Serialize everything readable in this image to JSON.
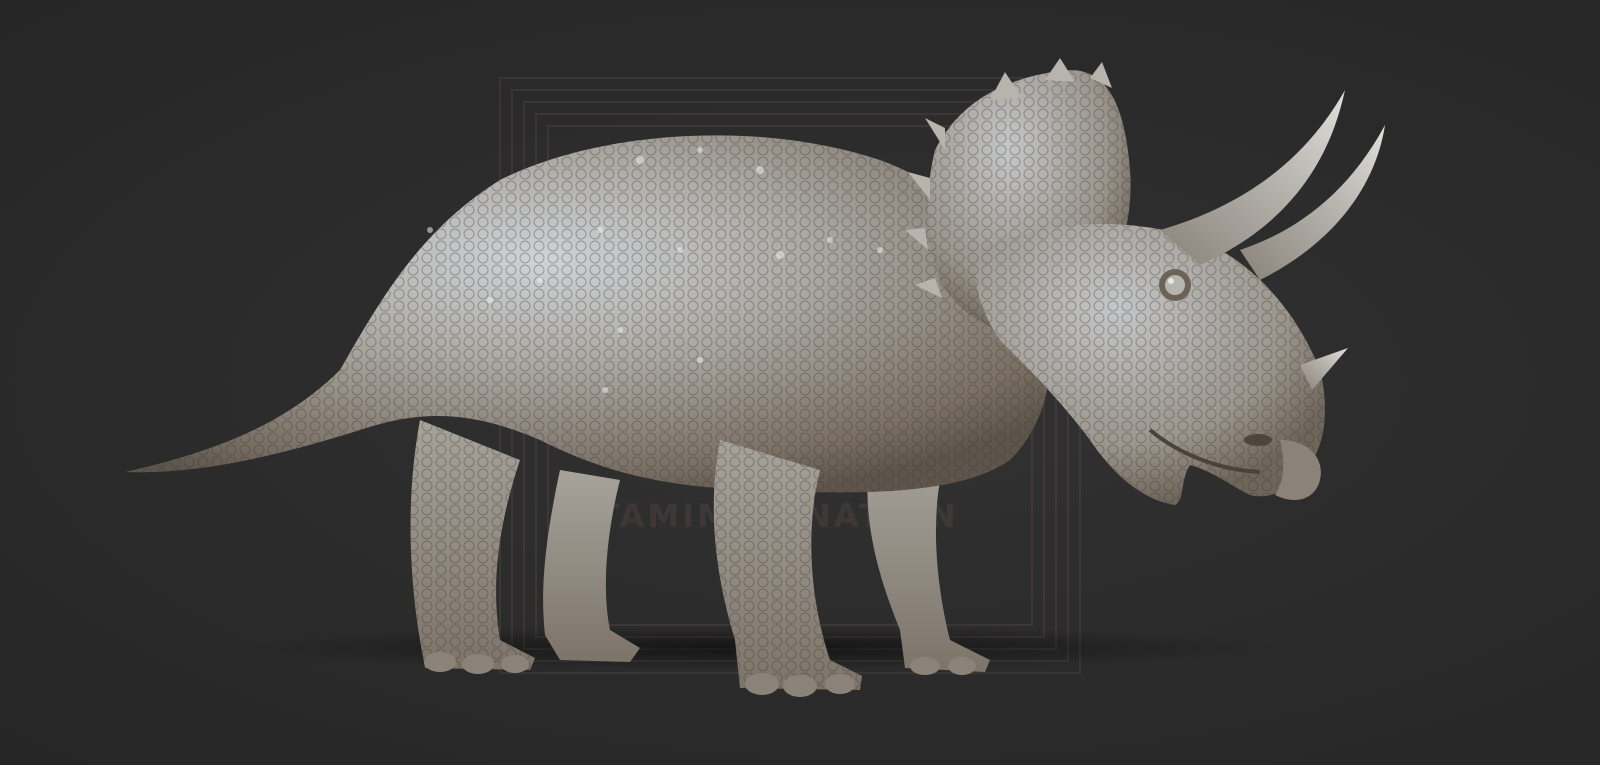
{
  "scene": {
    "subject": "triceratops-sculpt",
    "background_color": "#2b2b2b",
    "skin_highlight": "#c9cdd2",
    "skin_mid": "#9a9891",
    "skin_shadow": "#6e655a",
    "icons": [
      "watermark-frame-icon",
      "triceratops-icon"
    ]
  },
  "watermark": {
    "text": "TAMIMAGINATION"
  }
}
